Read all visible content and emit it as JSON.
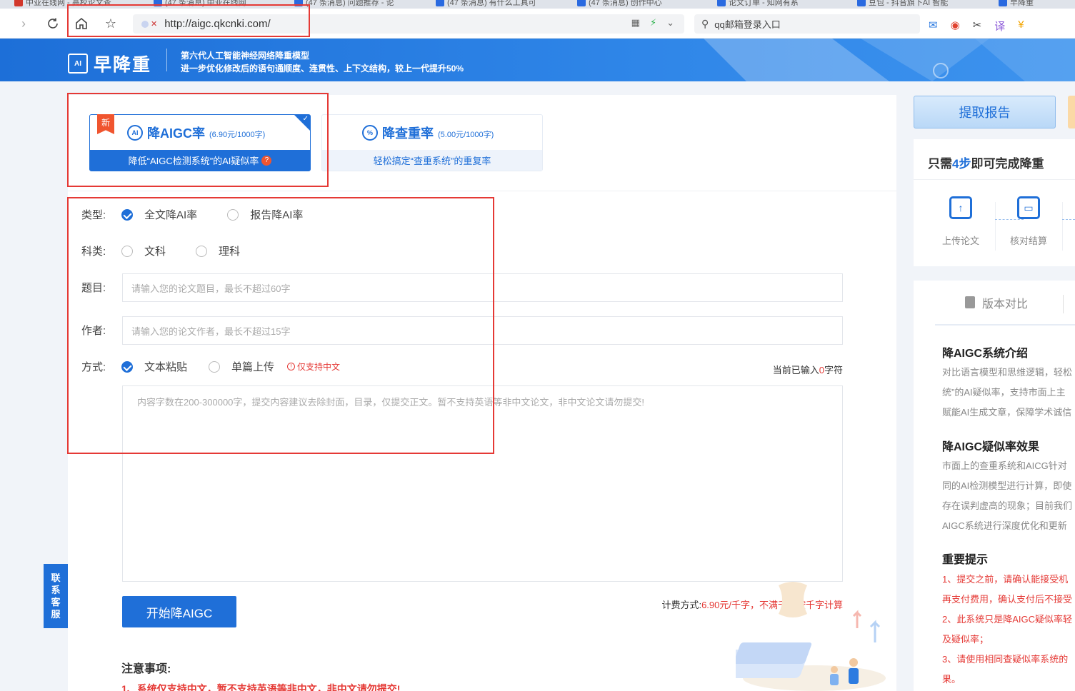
{
  "browser": {
    "tabs": [
      {
        "label": "中亚在线网 - 高校论文查",
        "favicon": "red"
      },
      {
        "label": "(47 条消息) 中亚在线网",
        "favicon": "blue"
      },
      {
        "label": "(47 条消息) 问题推荐 - 论",
        "favicon": "blue"
      },
      {
        "label": "(47 条消息) 有什么工具可",
        "favicon": "blue"
      },
      {
        "label": "(47 条消息) 创作中心",
        "favicon": "blue"
      },
      {
        "label": "论文订单 - 知网有系",
        "favicon": "blue"
      },
      {
        "label": "豆包 - 抖音旗下AI 智能",
        "favicon": "blue"
      },
      {
        "label": "早降重",
        "favicon": "blue"
      }
    ],
    "url": "http://aigc.qkcnki.com/",
    "search_text": "qq邮箱登录入口"
  },
  "banner": {
    "logo_text": "早降重",
    "logo_mark": "AI",
    "slogan_line1": "第六代人工智能神经网络降重模型",
    "slogan_line2": "进一步优化修改后的语句通顺度、连贯性、上下文结构，较上一代提升50%"
  },
  "products": [
    {
      "title": "降AIGC率",
      "price": "(6.90元/1000字)",
      "desc": "降低“AIGC检测系统”的AI疑似率",
      "tag": "新",
      "icon": "AI"
    },
    {
      "title": "降查重率",
      "price": "(5.00元/1000字)",
      "desc": "轻松搞定“查重系统”的重复率",
      "icon": "%"
    }
  ],
  "form": {
    "type_label": "类型:",
    "type_options": [
      "全文降AI率",
      "报告降AI率"
    ],
    "subject_label": "科类:",
    "subject_options": [
      "文科",
      "理科"
    ],
    "title_label": "题目:",
    "title_placeholder": "请输入您的论文题目，最长不超过60字",
    "author_label": "作者:",
    "author_placeholder": "请输入您的论文作者，最长不超过15字",
    "method_label": "方式:",
    "method_options": [
      "文本粘贴",
      "单篇上传"
    ],
    "only_chinese": "仅支持中文",
    "count_prefix": "当前已输入",
    "count_value": "0",
    "count_suffix": "字符",
    "content_placeholder": "内容字数在200-300000字，提交内容建议去除封面，目录，仅提交正文。暂不支持英语等非中文论文，非中文论文请勿提交!",
    "start_button": "开始降AIGC",
    "billing_prefix": "计费方式:",
    "billing_value": "6.90元/千字，不满千字按千字计算",
    "notice_title": "注意事项:",
    "notice_1": "1、系统仅支持中文，暂不支持英语等非中文，非中文请勿提交!"
  },
  "contact": {
    "label": "联系客服"
  },
  "sidebar": {
    "get_report": "提取报告",
    "steps_title_pre": "只需",
    "steps_title_num": "4步",
    "steps_title_post": "即可完成降重",
    "steps": [
      "上传论文",
      "核对结算"
    ],
    "intro_tab": "版本对比",
    "sections": [
      {
        "heading": "降AIGC系统介绍",
        "lines": [
          "对比语言模型和思维逻辑，轻松",
          "统”的AI疑似率，支持市面上主",
          "赋能AI生成文章，保障学术诚信"
        ]
      },
      {
        "heading": "降AIGC疑似率效果",
        "lines": [
          "市面上的查重系统和AICG针对",
          "同的AI检测模型进行计算，即使",
          "存在误判虚高的现象；目前我们",
          "AIGC系统进行深度优化和更新"
        ]
      },
      {
        "heading": "重要提示",
        "lines": [
          "1、提交之前，请确认能接受机",
          "再支付费用，确认支付后不接受",
          "2、此系统只是降AIGC疑似率轻",
          "及疑似率；",
          "3、请使用相同查疑似率系统的",
          "果。"
        ]
      }
    ]
  },
  "colors": {
    "primary": "#1f6fd8",
    "danger": "#e53935",
    "tag": "#f0552f"
  }
}
